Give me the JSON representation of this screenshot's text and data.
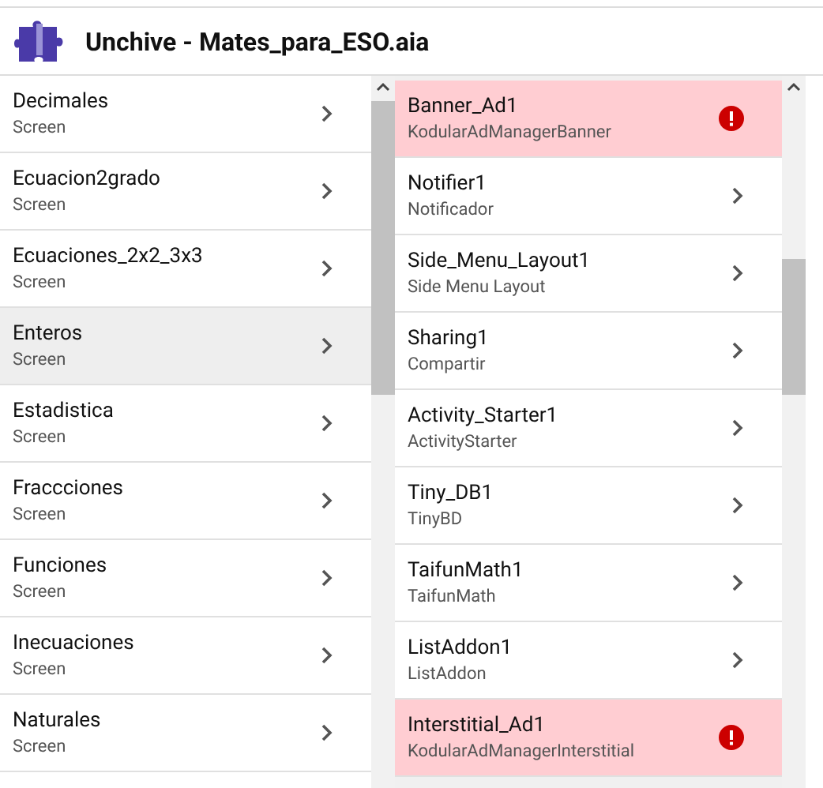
{
  "window": {
    "title": "Unchive - Mates_para_ESO.aia"
  },
  "screens": [
    {
      "name": "Decimales",
      "type": "Screen",
      "selected": false
    },
    {
      "name": "Ecuacion2grado",
      "type": "Screen",
      "selected": false
    },
    {
      "name": "Ecuaciones_2x2_3x3",
      "type": "Screen",
      "selected": false
    },
    {
      "name": "Enteros",
      "type": "Screen",
      "selected": true
    },
    {
      "name": "Estadistica",
      "type": "Screen",
      "selected": false
    },
    {
      "name": "Fraccciones",
      "type": "Screen",
      "selected": false
    },
    {
      "name": "Funciones",
      "type": "Screen",
      "selected": false
    },
    {
      "name": "Inecuaciones",
      "type": "Screen",
      "selected": false
    },
    {
      "name": "Naturales",
      "type": "Screen",
      "selected": false
    }
  ],
  "components": [
    {
      "name": "Banner_Ad1",
      "type": "KodularAdManagerBanner",
      "error": true
    },
    {
      "name": "Notifier1",
      "type": "Notificador",
      "error": false
    },
    {
      "name": "Side_Menu_Layout1",
      "type": "Side Menu Layout",
      "error": false
    },
    {
      "name": "Sharing1",
      "type": "Compartir",
      "error": false
    },
    {
      "name": "Activity_Starter1",
      "type": "ActivityStarter",
      "error": false
    },
    {
      "name": "Tiny_DB1",
      "type": "TinyBD",
      "error": false
    },
    {
      "name": "TaifunMath1",
      "type": "TaifunMath",
      "error": false
    },
    {
      "name": "ListAddon1",
      "type": "ListAddon",
      "error": false
    },
    {
      "name": "Interstitial_Ad1",
      "type": "KodularAdManagerInterstitial",
      "error": true
    }
  ]
}
